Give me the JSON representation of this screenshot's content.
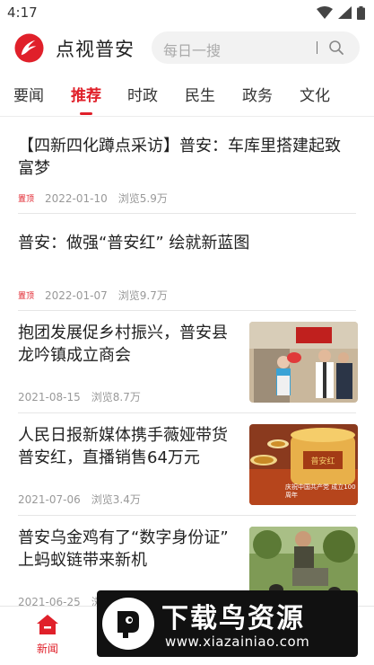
{
  "status_bar": {
    "time": "4:17"
  },
  "header": {
    "app_name": "点视普安",
    "search_placeholder": "每日一搜"
  },
  "tabs": [
    {
      "label": "要闻",
      "active": false
    },
    {
      "label": "推荐",
      "active": true
    },
    {
      "label": "时政",
      "active": false
    },
    {
      "label": "民生",
      "active": false
    },
    {
      "label": "政务",
      "active": false
    },
    {
      "label": "文化",
      "active": false
    }
  ],
  "feed": [
    {
      "title_line1": "【四新四化蹲点采访】普安：车库里搭建起致",
      "title_line2": "富梦",
      "badge": "置顶",
      "date": "2022-01-10",
      "views": "浏览5.9万"
    },
    {
      "title_line1": "普安：做强“普安红” 绘就新蓝图",
      "title_line2": "",
      "badge": "置顶",
      "date": "2022-01-07",
      "views": "浏览9.7万"
    },
    {
      "title_line1": "抱团发展促乡村振兴，普安县",
      "title_line2": "龙吟镇成立商会",
      "date": "2021-08-15",
      "views": "浏览8.7万",
      "thumb": "ceremony-photo"
    },
    {
      "title_line1": "人民日报新媒体携手薇娅带货",
      "title_line2": "普安红，直播销售64万元",
      "date": "2021-07-06",
      "views": "浏览3.4万",
      "thumb": "tea-photo",
      "thumb_text": "庆祝中国共产党 成立100周年"
    },
    {
      "title_line1": "普安乌金鸡有了“数字身份证”",
      "title_line2": "上蚂蚁链带来新机",
      "date": "2021-06-25",
      "views": "浏览",
      "thumb": "chicken-farm-photo"
    }
  ],
  "bottom_nav": {
    "home_label": "新闻"
  },
  "watermark": {
    "title": "下载鸟资源",
    "url": "www.xiazainiao.com"
  },
  "colors": {
    "accent": "#e0202a"
  }
}
